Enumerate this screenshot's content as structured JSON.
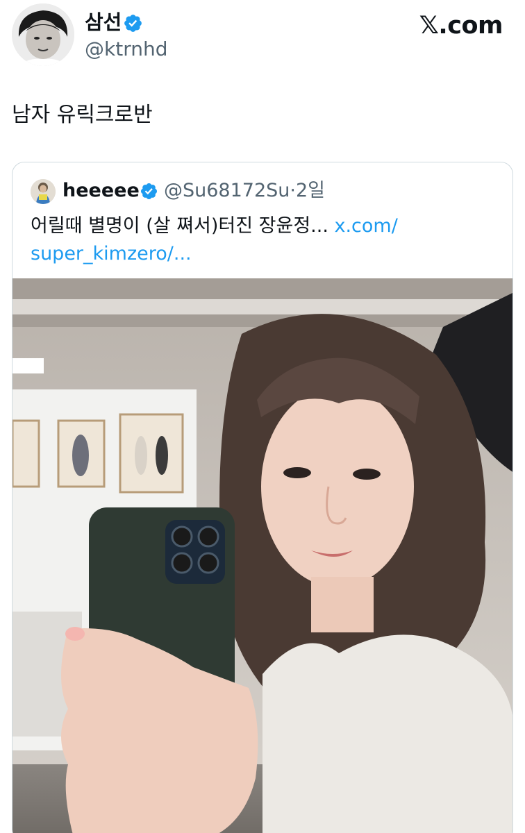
{
  "author": {
    "display_name": "삼선",
    "handle": "@ktrnhd"
  },
  "site_label": "𝕏.com",
  "tweet": {
    "text": "남자 유릭크로반"
  },
  "quoted": {
    "display_name": "heeeee",
    "handle": "@Su68172Su",
    "separator": "·",
    "time": "2일",
    "text": "어릴때 별명이 (살 쪄서)터진 장윤정... ",
    "link": "x.com/ super_kimzero/..."
  },
  "colors": {
    "verified_blue": "#1d9bf0",
    "link_blue": "#1d9bf0",
    "secondary_text": "#536471",
    "border": "#cfd9de"
  },
  "icons": {
    "verified": "verified-badge-icon"
  }
}
